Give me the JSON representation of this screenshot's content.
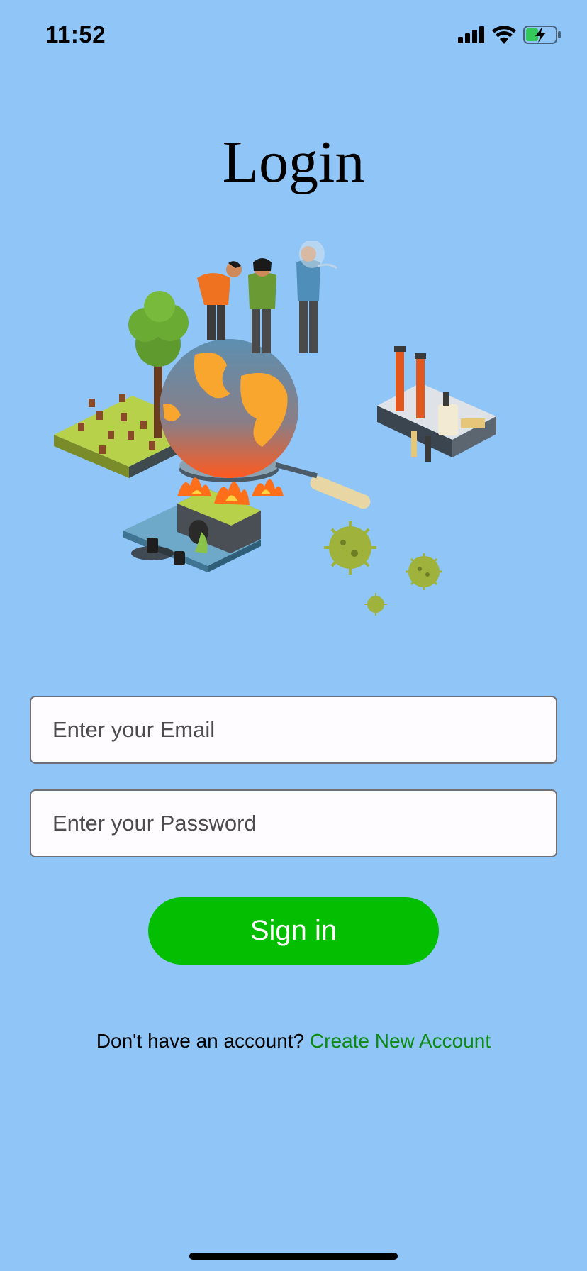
{
  "status_bar": {
    "time": "11:52",
    "icons": [
      "signal-icon",
      "wifi-icon",
      "battery-charging-icon"
    ]
  },
  "page": {
    "title": "Login",
    "background_color": "#8fc5f7"
  },
  "illustration": {
    "icon": "environmental-pollution-illustration"
  },
  "form": {
    "email_placeholder": "Enter your Email",
    "password_placeholder": "Enter your Password",
    "signin_label": "Sign in",
    "signin_color": "#04be02"
  },
  "footer": {
    "prompt": "Don't have an account?",
    "create_link": "Create New Account",
    "link_color": "#0c8a12"
  }
}
